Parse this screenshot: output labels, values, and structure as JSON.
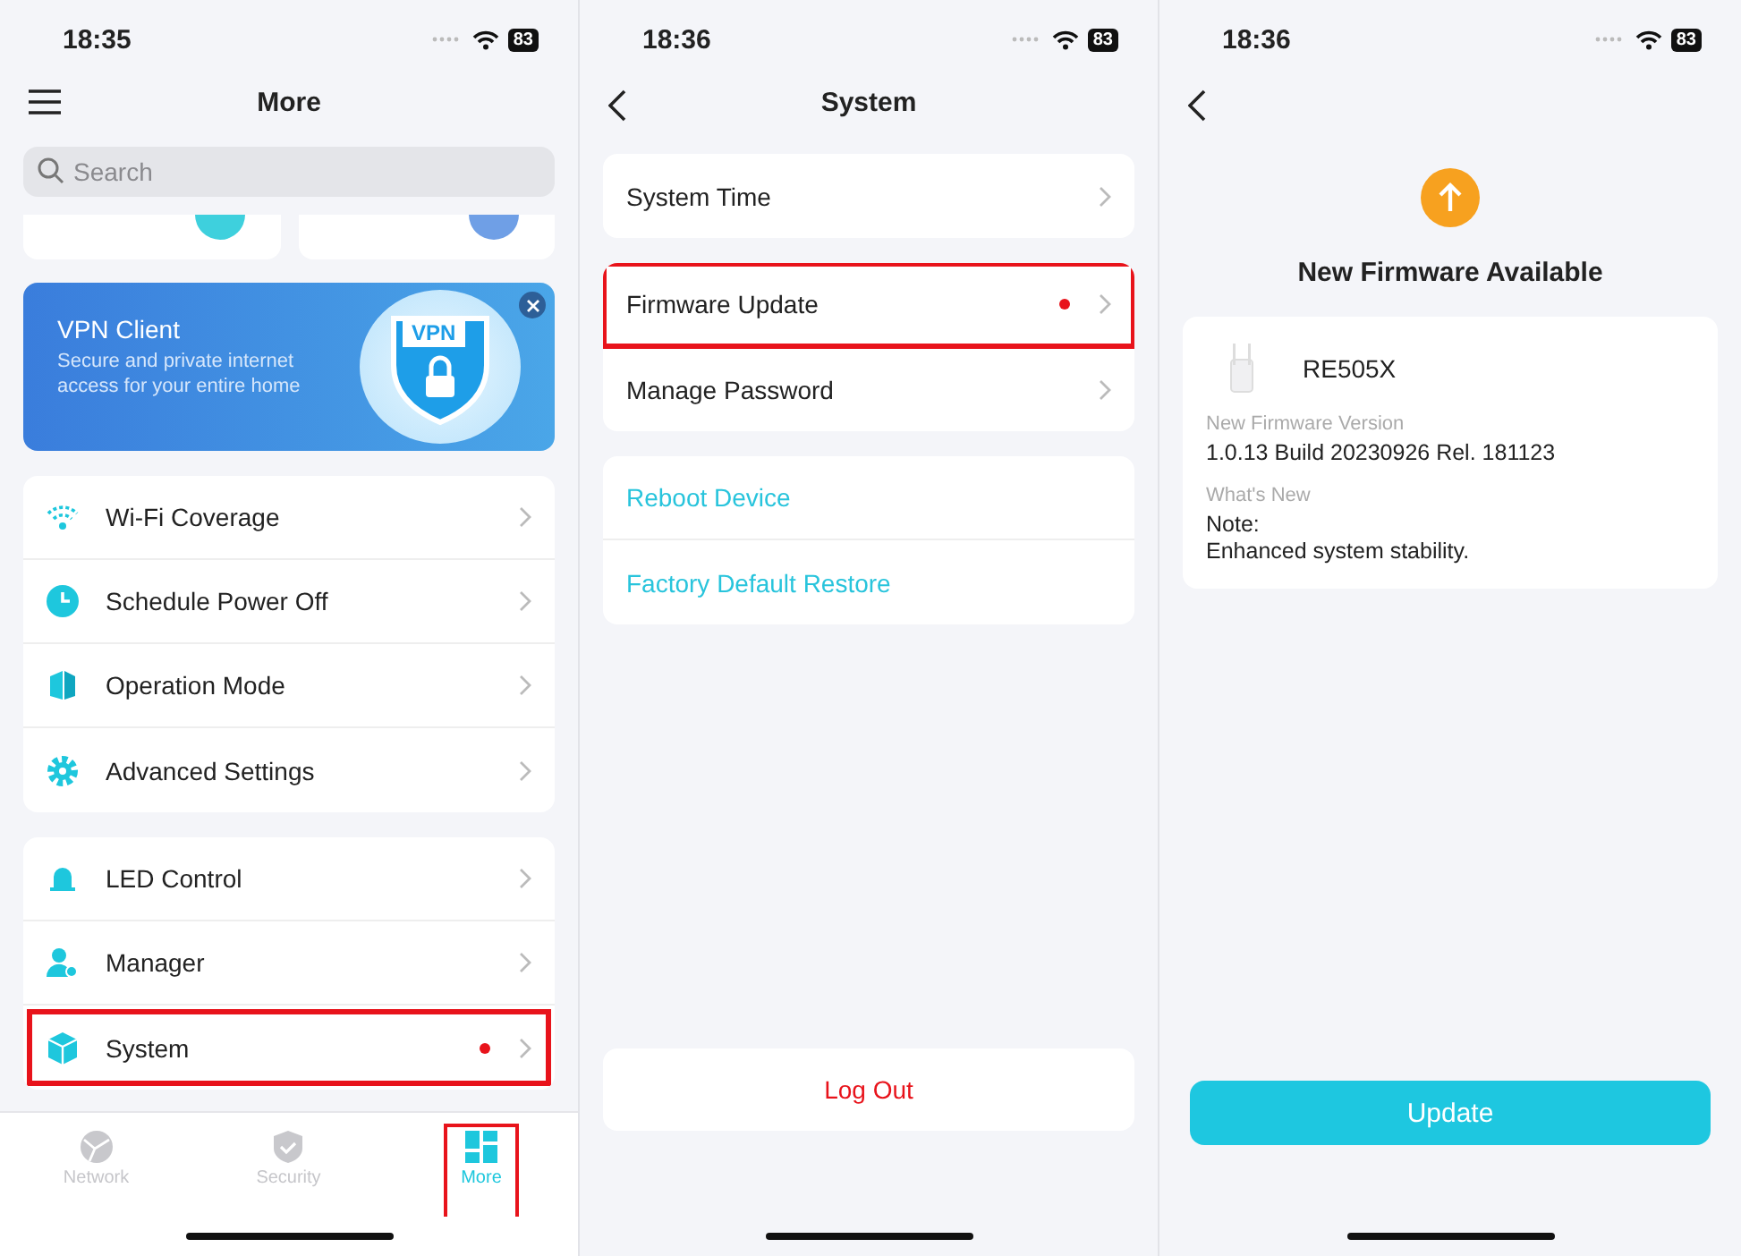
{
  "more_screen": {
    "status_bar": {
      "time": "18:35",
      "battery": "83"
    },
    "title": "More",
    "search": {
      "placeholder": "Search"
    },
    "banner": {
      "title": "VPN Client",
      "text": "Secure and private internet access for your entire home",
      "badge": "VPN"
    },
    "groups": [
      [
        {
          "label": "Wi-Fi Coverage",
          "dot": false,
          "highlighted": false
        },
        {
          "label": "Schedule Power Off",
          "dot": false,
          "highlighted": false
        },
        {
          "label": "Operation Mode",
          "dot": false,
          "highlighted": false
        },
        {
          "label": "Advanced Settings",
          "dot": false,
          "highlighted": false
        }
      ],
      [
        {
          "label": "LED Control",
          "dot": false,
          "highlighted": false
        },
        {
          "label": "Manager",
          "dot": false,
          "highlighted": false
        },
        {
          "label": "System",
          "dot": true,
          "highlighted": true
        }
      ]
    ],
    "tabs": [
      {
        "label": "Network",
        "selected": false,
        "highlighted": false
      },
      {
        "label": "Security",
        "selected": false,
        "highlighted": false
      },
      {
        "label": "More",
        "selected": true,
        "highlighted": true
      }
    ]
  },
  "system_screen": {
    "status_bar": {
      "time": "18:36",
      "battery": "83"
    },
    "title": "System",
    "groups": [
      [
        {
          "label": "System Time",
          "kind": "nav",
          "dot": false,
          "highlighted": false
        }
      ],
      [
        {
          "label": "Firmware Update",
          "kind": "nav",
          "dot": true,
          "highlighted": true
        },
        {
          "label": "Manage Password",
          "kind": "nav",
          "dot": false,
          "highlighted": false
        }
      ],
      [
        {
          "label": "Reboot Device",
          "kind": "action",
          "dot": false,
          "highlighted": false
        },
        {
          "label": "Factory Default Restore",
          "kind": "action",
          "dot": false,
          "highlighted": false
        }
      ]
    ],
    "logout": "Log Out"
  },
  "firmware_screen": {
    "status_bar": {
      "time": "18:36",
      "battery": "83"
    },
    "title": "New Firmware Available",
    "device": "RE505X",
    "fields": [
      {
        "label": "New Firmware Version",
        "lines": [
          "1.0.13 Build 20230926 Rel. 181123"
        ]
      },
      {
        "label": "What's New",
        "lines": [
          "Note:",
          "Enhanced system stability."
        ]
      }
    ],
    "button": "Update"
  }
}
